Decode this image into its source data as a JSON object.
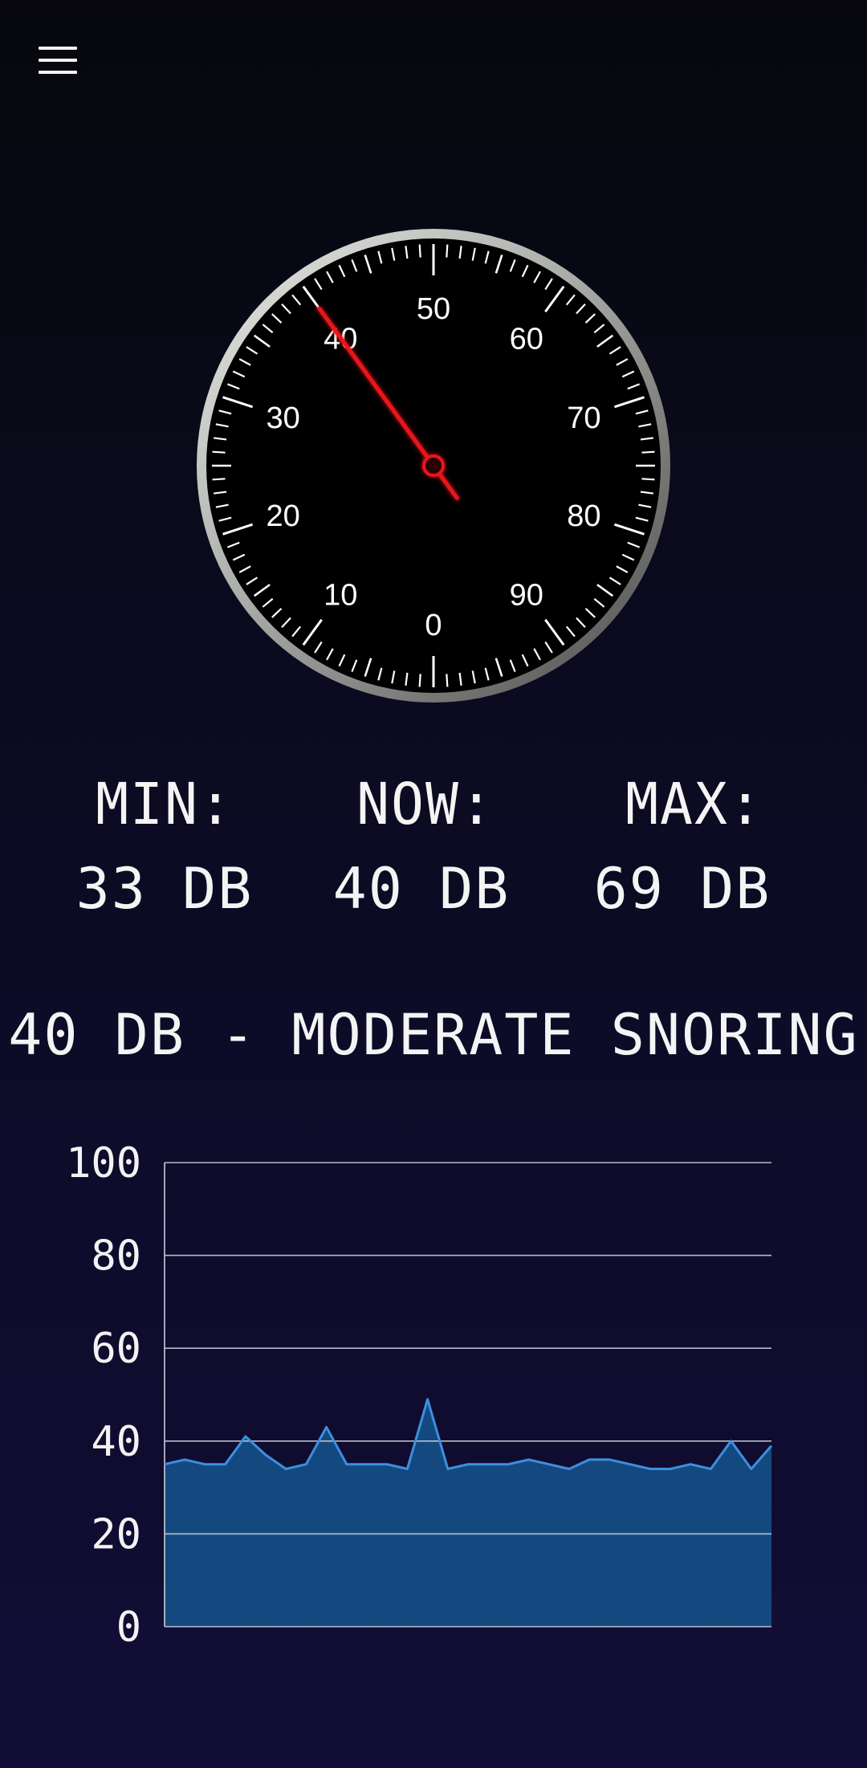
{
  "header": {
    "menu_icon": "hamburger-menu-icon"
  },
  "gauge": {
    "reading": 40,
    "min": 0,
    "max": 100,
    "labels": [
      "0",
      "10",
      "20",
      "30",
      "40",
      "50",
      "60",
      "70",
      "80",
      "90"
    ],
    "needle_color": "#e8161b"
  },
  "stats": {
    "min_label": "MIN:",
    "min_value": "33 DB",
    "now_label": "NOW:",
    "now_value": "40 DB",
    "max_label": "MAX:",
    "max_value": "69 DB"
  },
  "status": {
    "text": "40 DB - MODERATE SNORING"
  },
  "chart_data": {
    "type": "area",
    "ylim": [
      0,
      100
    ],
    "y_ticks": [
      "0",
      "20",
      "40",
      "60",
      "80",
      "100"
    ],
    "grid": true,
    "fill_color": "#14497f",
    "line_color": "#3d8fe0",
    "values": [
      35,
      36,
      35,
      35,
      41,
      37,
      34,
      35,
      43,
      35,
      35,
      35,
      34,
      49,
      34,
      35,
      35,
      35,
      36,
      35,
      34,
      36,
      36,
      35,
      34,
      34,
      35,
      34,
      40,
      34,
      39
    ]
  }
}
